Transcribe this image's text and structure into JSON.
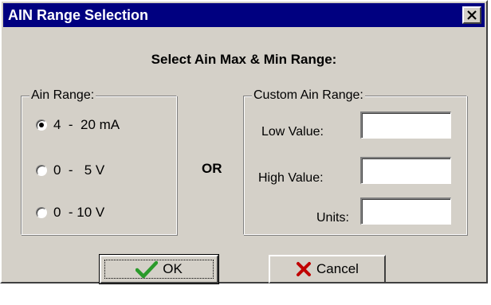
{
  "window": {
    "title": "AIN Range Selection",
    "close_glyph": "✕"
  },
  "heading": "Select Ain Max & Min Range:",
  "ain_range": {
    "legend": "Ain Range:",
    "options": [
      {
        "label": "4  -  20 mA",
        "checked": true
      },
      {
        "label": "0  -   5 V",
        "checked": false
      },
      {
        "label": "0  - 10 V",
        "checked": false
      }
    ]
  },
  "or_label": "OR",
  "custom_range": {
    "legend": "Custom Ain Range:",
    "low_label": "Low Value:",
    "low_value": "",
    "high_label": "High Value:",
    "high_value": "",
    "units_label": "Units:",
    "units_value": ""
  },
  "buttons": {
    "ok_label": "OK",
    "cancel_label": "Cancel"
  },
  "colors": {
    "titlebar": "#000080",
    "face": "#d4d0c8",
    "ok_icon": "#2a9a2a",
    "cancel_icon": "#c00000"
  },
  "icons": {
    "ok": "checkmark-icon",
    "cancel": "x-icon",
    "close": "close-icon"
  }
}
